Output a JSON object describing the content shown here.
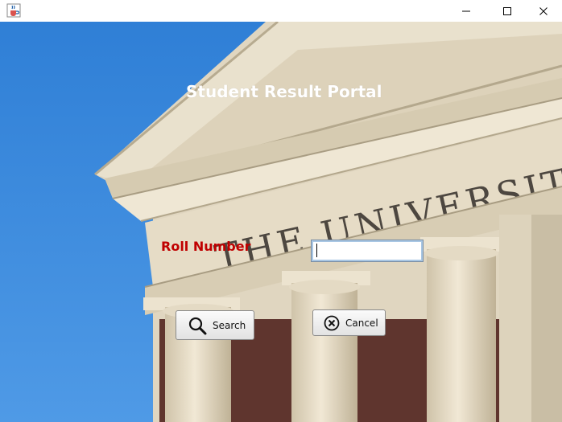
{
  "window": {
    "app_icon": "java-coffee-cup-icon",
    "controls": [
      "minimize-icon",
      "maximize-icon",
      "close-icon"
    ]
  },
  "portal": {
    "title": "Student Result Portal"
  },
  "form": {
    "roll_label": "Roll Number",
    "roll_value": "",
    "search_label": "Search",
    "cancel_label": "Cancel"
  },
  "colors": {
    "title_text": "#ffffff",
    "roll_label_text": "#c00000",
    "sky": "#3b86d8",
    "stone": "#e2d8c2"
  }
}
